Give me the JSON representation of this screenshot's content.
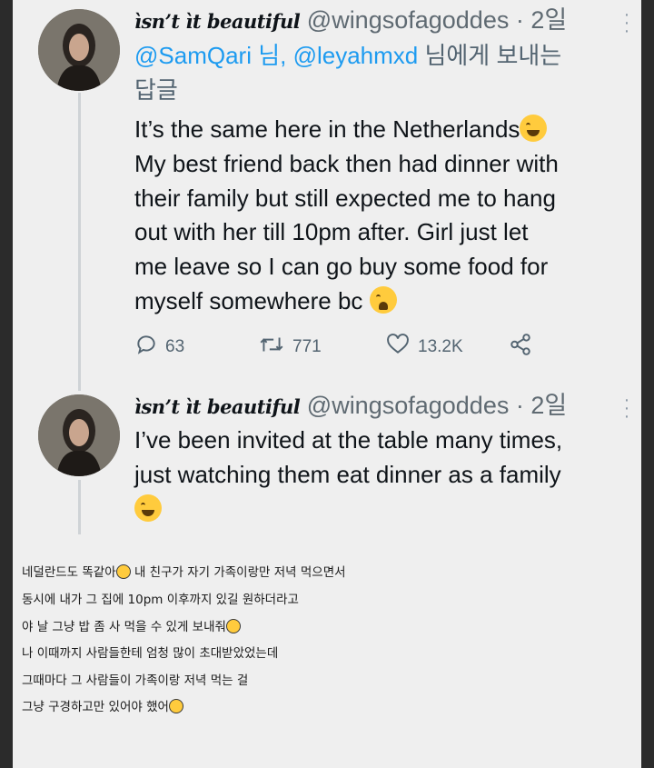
{
  "tweets": [
    {
      "name": "ìsn’t ìt beautiful",
      "handle": "@wingsofagoddes",
      "separator": " · ",
      "time": "2일",
      "reply_mentions": "@SamQari 님, @leyahmxd",
      "reply_suffix": " 님에게 보내는",
      "reply_suffix2": "답글",
      "lines": [
        "It’s the same here in the Netherlands",
        "My best friend back then had dinner with",
        "their family but still expected me to hang",
        "out with her till 10pm after. Girl just let",
        "me leave so I can go buy some food for",
        "myself somewhere bc"
      ],
      "stats": {
        "replies": "63",
        "retweets": "771",
        "likes": "13.2K"
      }
    },
    {
      "name": "ìsn’t ìt beautiful",
      "handle": "@wingsofagoddes",
      "separator": " · ",
      "time": "2일",
      "lines": [
        "I’ve been invited at the table many times,",
        "just watching them eat dinner as a family"
      ]
    }
  ],
  "translation": [
    {
      "before": "네덜란드도 똑같아",
      "emoji": true,
      "after": " 내 친구가 자기 가족이랑만 저녁 먹으면서"
    },
    {
      "before": "동시에 내가 그 집에 10pm 이후까지 있길 원하더라고",
      "emoji": false,
      "after": ""
    },
    {
      "before": "야 날 그냥 밥 좀 사 먹을 수 있게 보내줘",
      "emoji": true,
      "after": ""
    },
    {
      "before": "나 이때까지 사람들한테 엄청 많이 초대받았었는데",
      "emoji": false,
      "after": ""
    },
    {
      "before": "그때마다 그 사람들이 가족이랑 저녁 먹는 걸",
      "emoji": false,
      "after": ""
    },
    {
      "before": "그냥 구경하고만 있어야 했어",
      "emoji": true,
      "after": ""
    }
  ],
  "icons": {
    "reply": "speech-bubble-icon",
    "retweet": "retweet-icon",
    "like": "heart-icon",
    "share": "share-icon",
    "more": "more-vertical-icon"
  }
}
